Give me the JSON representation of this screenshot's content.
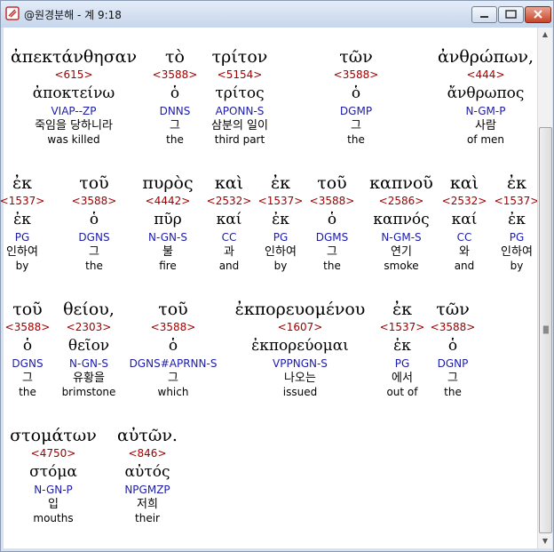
{
  "window": {
    "title": "@원경분해 - 계 9:18"
  },
  "rows": [
    {
      "words": [
        {
          "greek": "ἀπεκτάνθησαν",
          "strong": "<615>",
          "lemma": "ἀποκτείνω",
          "parse": "VIAP--ZP",
          "korean": "죽임을 당하니라",
          "english": "was killed"
        },
        {
          "greek": "τὸ",
          "strong": "<3588>",
          "lemma": "ὁ",
          "parse": "DNNS",
          "korean": "그",
          "english": "the"
        },
        {
          "greek": "τρίτον",
          "strong": "<5154>",
          "lemma": "τρίτος",
          "parse": "APONN-S",
          "korean": "삼분의 일이",
          "english": "third part"
        },
        {
          "greek": "τῶν",
          "strong": "<3588>",
          "lemma": "ὁ",
          "parse": "DGMP",
          "korean": "그",
          "english": "the"
        },
        {
          "greek": "ἀνθρώπων,",
          "strong": "<444>",
          "lemma": "ἄνθρωπος",
          "parse": "N-GM-P",
          "korean": "사람",
          "english": "of men"
        }
      ]
    },
    {
      "words": [
        {
          "greek": "ἐκ",
          "strong": "<1537>",
          "lemma": "ἐκ",
          "parse": "PG",
          "korean": "인하여",
          "english": "by"
        },
        {
          "greek": "τοῦ",
          "strong": "<3588>",
          "lemma": "ὁ",
          "parse": "DGNS",
          "korean": "그",
          "english": "the"
        },
        {
          "greek": "πυρὸς",
          "strong": "<4442>",
          "lemma": "πῦρ",
          "parse": "N-GN-S",
          "korean": "불",
          "english": "fire"
        },
        {
          "greek": "καὶ",
          "strong": "<2532>",
          "lemma": "καί",
          "parse": "CC",
          "korean": "과",
          "english": "and"
        },
        {
          "greek": "ἐκ",
          "strong": "<1537>",
          "lemma": "ἐκ",
          "parse": "PG",
          "korean": "인하여",
          "english": "by"
        },
        {
          "greek": "τοῦ",
          "strong": "<3588>",
          "lemma": "ὁ",
          "parse": "DGMS",
          "korean": "그",
          "english": "the"
        },
        {
          "greek": "καπνοῦ",
          "strong": "<2586>",
          "lemma": "καπνός",
          "parse": "N-GM-S",
          "korean": "연기",
          "english": "smoke"
        },
        {
          "greek": "καὶ",
          "strong": "<2532>",
          "lemma": "καί",
          "parse": "CC",
          "korean": "와",
          "english": "and"
        },
        {
          "greek": "ἐκ",
          "strong": "<1537>",
          "lemma": "ἐκ",
          "parse": "PG",
          "korean": "인하여",
          "english": "by"
        }
      ]
    },
    {
      "words": [
        {
          "greek": "τοῦ",
          "strong": "<3588>",
          "lemma": "ὁ",
          "parse": "DGNS",
          "korean": "그",
          "english": "the"
        },
        {
          "greek": "θείου,",
          "strong": "<2303>",
          "lemma": "θεῖον",
          "parse": "N-GN-S",
          "korean": "유황을",
          "english": "brimstone"
        },
        {
          "greek": "τοῦ",
          "strong": "<3588>",
          "lemma": "ὁ",
          "parse": "DGNS#APRNN-S",
          "korean": "그",
          "english": "which"
        },
        {
          "greek": "ἐκπορευομένου",
          "strong": "<1607>",
          "lemma": "ἐκπορεύομαι",
          "parse": "VPPNGN-S",
          "korean": "나오는",
          "english": "issued"
        },
        {
          "greek": "ἐκ",
          "strong": "<1537>",
          "lemma": "ἐκ",
          "parse": "PG",
          "korean": "에서",
          "english": "out of"
        },
        {
          "greek": "τῶν",
          "strong": "<3588>",
          "lemma": "ὁ",
          "parse": "DGNP",
          "korean": "그",
          "english": "the"
        }
      ]
    },
    {
      "words": [
        {
          "greek": "στομάτων",
          "strong": "<4750>",
          "lemma": "στόμα",
          "parse": "N-GN-P",
          "korean": "입",
          "english": "mouths"
        },
        {
          "greek": "αὐτῶν.",
          "strong": "<846>",
          "lemma": "αὐτός",
          "parse": "NPGMZP",
          "korean": "저희",
          "english": "their"
        }
      ]
    }
  ]
}
